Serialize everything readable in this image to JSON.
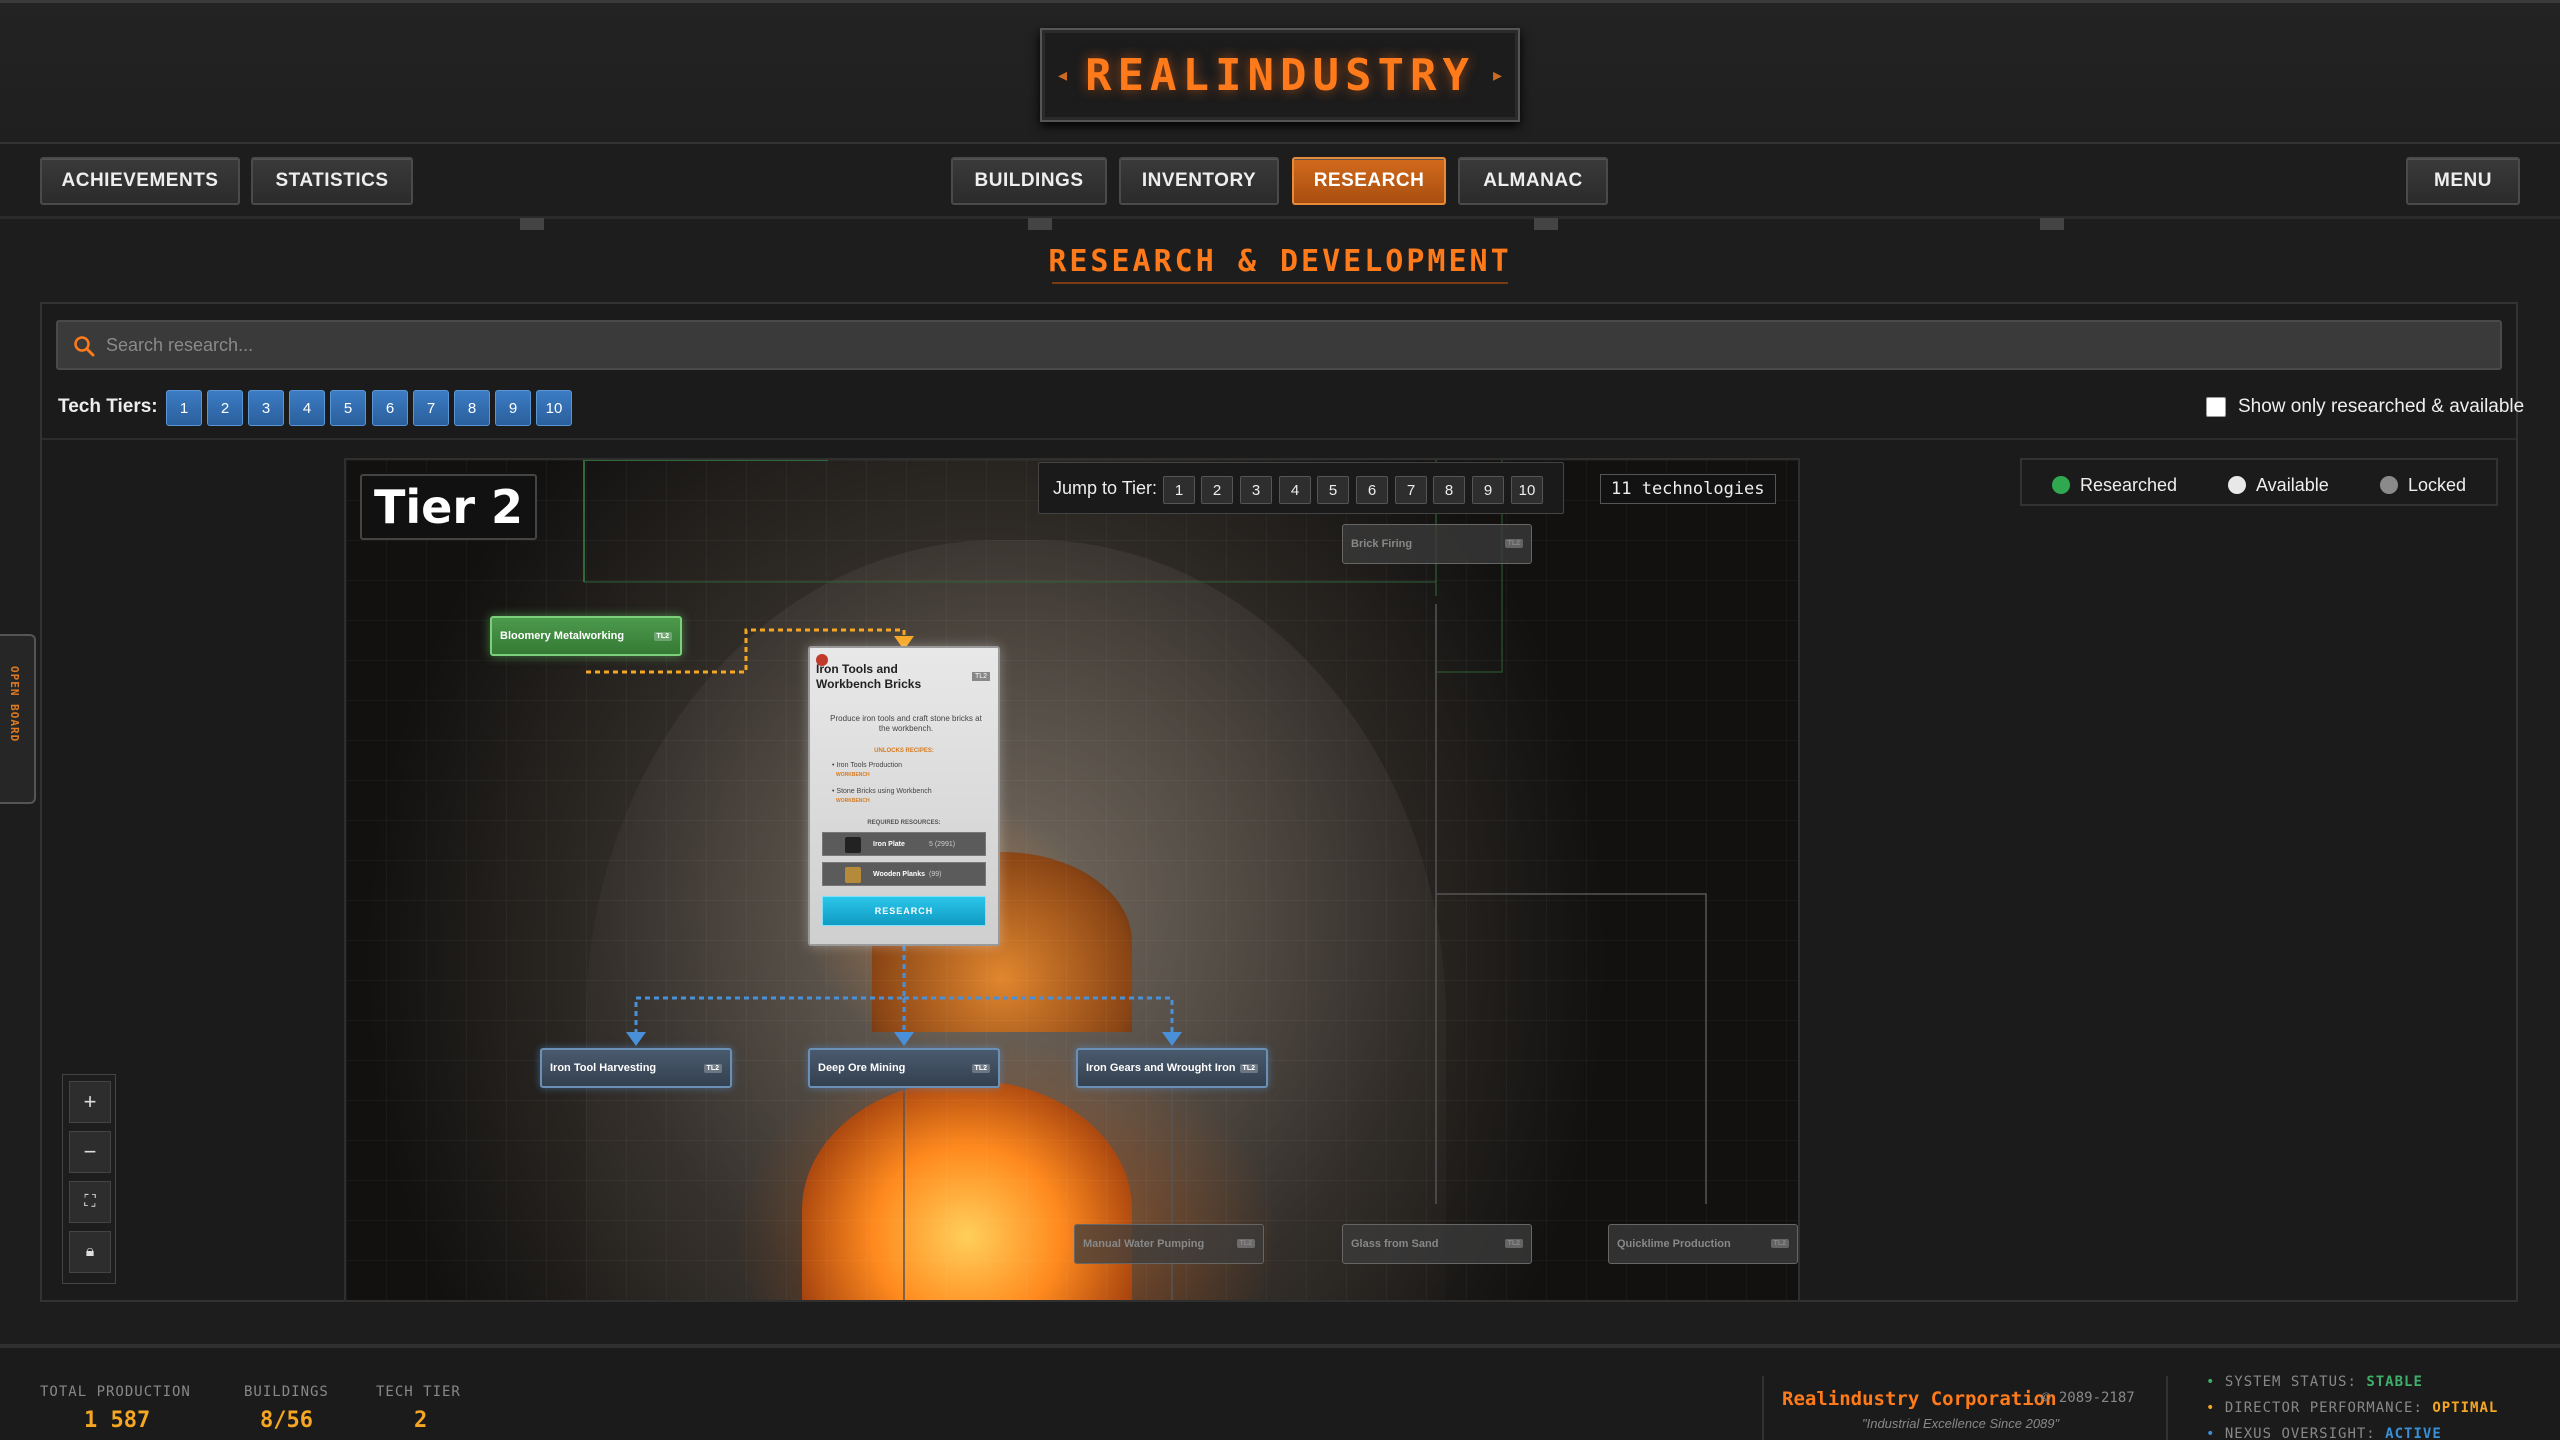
{
  "header": {
    "title": "REALINDUSTRY",
    "left_tabs": [
      "ACHIEVEMENTS",
      "STATISTICS"
    ],
    "center_tabs": [
      "BUILDINGS",
      "INVENTORY",
      "RESEARCH",
      "ALMANAC"
    ],
    "active_tab": "RESEARCH",
    "menu_label": "MENU"
  },
  "page_title": "RESEARCH & DEVELOPMENT",
  "search": {
    "placeholder": "Search research...",
    "value": ""
  },
  "tiers": {
    "label": "Tech Tiers:",
    "values": [
      "1",
      "2",
      "3",
      "4",
      "5",
      "6",
      "7",
      "8",
      "9",
      "10"
    ]
  },
  "filter": {
    "label": "Show only researched & available",
    "checked": false
  },
  "tree": {
    "tier_heading": "Tier 2",
    "jump_label": "Jump to Tier:",
    "jump_values": [
      "1",
      "2",
      "3",
      "4",
      "5",
      "6",
      "7",
      "8",
      "9",
      "10"
    ],
    "tech_count": "11 technologies",
    "nodes": {
      "bloomery": "Bloomery Metalworking",
      "brick_firing": "Brick Firing",
      "iron_tool_harvesting": "Iron Tool Harvesting",
      "deep_ore_mining": "Deep Ore Mining",
      "iron_gears": "Iron Gears and Wrought Iron",
      "manual_water": "Manual Water Pumping",
      "glass": "Glass from Sand",
      "quicklime": "Quicklime Production",
      "tier_tag": "TL2"
    },
    "selected_card": {
      "title": "Iron Tools and Workbench Bricks",
      "tag": "TL2",
      "description": "Produce iron tools and craft stone bricks at the workbench.",
      "unlocks_label": "UNLOCKS RECIPES:",
      "unlocks": [
        "Iron Tools Production",
        "Stone Bricks using Workbench"
      ],
      "unlock_badge": "WORKBENCH",
      "required_label": "REQUIRED RESOURCES:",
      "resources": [
        {
          "name": "Iron Plate",
          "qty": "5 (2991)"
        },
        {
          "name": "Wooden Planks",
          "qty": "(99)"
        }
      ],
      "research_button": "RESEARCH"
    }
  },
  "legend": {
    "items": [
      {
        "label": "Researched",
        "color": "#2fa84f"
      },
      {
        "label": "Available",
        "color": "#e8e8e8"
      },
      {
        "label": "Locked",
        "color": "#8a8a8a"
      }
    ]
  },
  "side_tab": "OPEN BOARD",
  "footer": {
    "stats": [
      {
        "label": "TOTAL PRODUCTION",
        "value": "1 587"
      },
      {
        "label": "BUILDINGS",
        "value": "8/56"
      },
      {
        "label": "TECH TIER",
        "value": "2"
      }
    ],
    "corp_name": "Realindustry Corporation",
    "corp_years": "© 2089-2187",
    "corp_slogan": "\"Industrial Excellence Since 2089\"",
    "system": [
      {
        "label": "SYSTEM STATUS:",
        "value": "STABLE",
        "color": "#3fae6a"
      },
      {
        "label": "DIRECTOR PERFORMANCE:",
        "value": "OPTIMAL",
        "color": "#f5a623"
      },
      {
        "label": "NEXUS OVERSIGHT:",
        "value": "ACTIVE",
        "color": "#3a8fd6"
      }
    ]
  },
  "colors": {
    "accent": "#ff7a1a",
    "tier_button": "#2a6ab0",
    "active_tab": "#c0601a"
  }
}
